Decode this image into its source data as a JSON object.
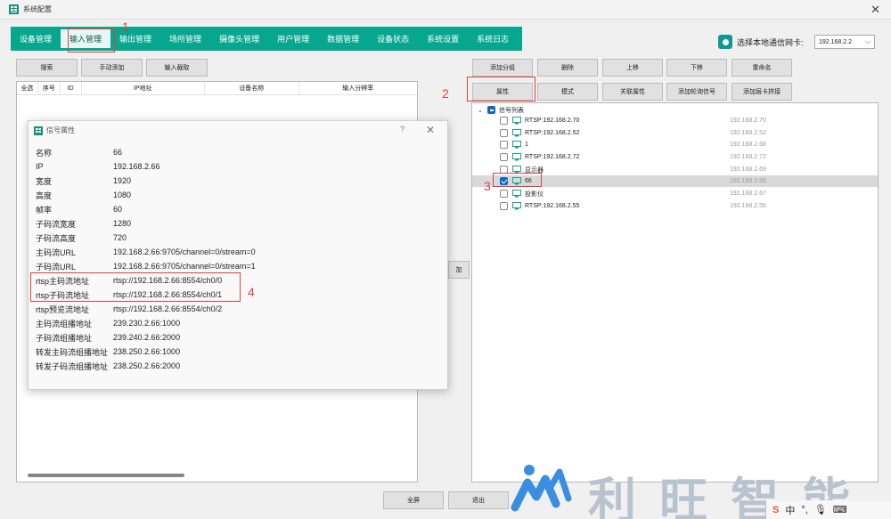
{
  "window": {
    "title": "系统配置",
    "close_glyph": "✕"
  },
  "nav": {
    "items": [
      "设备管理",
      "输入管理",
      "输出管理",
      "场所管理",
      "摄像头管理",
      "用户管理",
      "数据管理",
      "设备状态",
      "系统设置",
      "系统日志"
    ],
    "active_index": 1,
    "accent": "#07a68e"
  },
  "nic": {
    "label": "选择本地通信网卡:",
    "value": "192.168.2.2"
  },
  "left_toolbar": {
    "search": "搜索",
    "manual_add": "手动添加",
    "import": "输入截取"
  },
  "table": {
    "columns": [
      "全选",
      "序号",
      "ID",
      "IP地址",
      "设备名称",
      "输入分辨率"
    ]
  },
  "mid_button": "加",
  "right_toolbar": {
    "row1": [
      "添加分组",
      "删除",
      "上移",
      "下移",
      "重命名"
    ],
    "row2": [
      "属性",
      "模式",
      "关联属性",
      "添加轮询信号",
      "添加层卡拼接"
    ]
  },
  "tree": {
    "root": "信号列表",
    "items": [
      {
        "name": "RTSP:192.168.2.70",
        "ip": "192.168.2.70",
        "checked": false
      },
      {
        "name": "RTSP:192.168.2.52",
        "ip": "192.168.2.52",
        "checked": false
      },
      {
        "name": "1",
        "ip": "192.168.2.68",
        "checked": false
      },
      {
        "name": "RTSP:192.168.2.72",
        "ip": "192.168.2.72",
        "checked": false
      },
      {
        "name": "显示器",
        "ip": "192.168.2.69",
        "checked": false
      },
      {
        "name": "66",
        "ip": "192.168.2.66",
        "checked": true
      },
      {
        "name": "投影仪",
        "ip": "192.168.2.67",
        "checked": false
      },
      {
        "name": "RTSP:192.168.2.55",
        "ip": "192.168.2.55",
        "checked": false
      }
    ]
  },
  "dialog": {
    "title": "信号属性",
    "help": "?",
    "close_glyph": "✕",
    "props": [
      {
        "key": "名称",
        "value": "66"
      },
      {
        "key": "IP",
        "value": "192.168.2.66"
      },
      {
        "key": "宽度",
        "value": "1920"
      },
      {
        "key": "高度",
        "value": "1080"
      },
      {
        "key": "帧率",
        "value": "60"
      },
      {
        "key": "子码流宽度",
        "value": "1280"
      },
      {
        "key": "子码流高度",
        "value": "720"
      },
      {
        "key": "主码流URL",
        "value": "192.168.2.66:9705/channel=0/stream=0"
      },
      {
        "key": "子码流URL",
        "value": "192.168.2.66:9705/channel=0/stream=1"
      },
      {
        "key": "rtsp主码流地址",
        "value": "rtsp://192.168.2.66:8554/ch0/0"
      },
      {
        "key": "rtsp子码流地址",
        "value": "rtsp://192.168.2.66:8554/ch0/1"
      },
      {
        "key": "rtsp预览流地址",
        "value": "rtsp://192.168.2.66:8554/ch0/2"
      },
      {
        "key": "主码流组播地址",
        "value": "239.230.2.66:1000"
      },
      {
        "key": "子码流组播地址",
        "value": "239.240.2.66:2000"
      },
      {
        "key": "转发主码流组播地址",
        "value": "238.250.2.66:1000"
      },
      {
        "key": "转发子码流组播地址",
        "value": "238.250.2.66:2000"
      }
    ]
  },
  "bottom": {
    "fullscreen": "全屏",
    "exit": "退出"
  },
  "annotations": [
    "1",
    "2",
    "3",
    "4"
  ],
  "watermark": {
    "text": "利旺智能"
  },
  "tray": {
    "ime": "中",
    "punct": "°,"
  }
}
